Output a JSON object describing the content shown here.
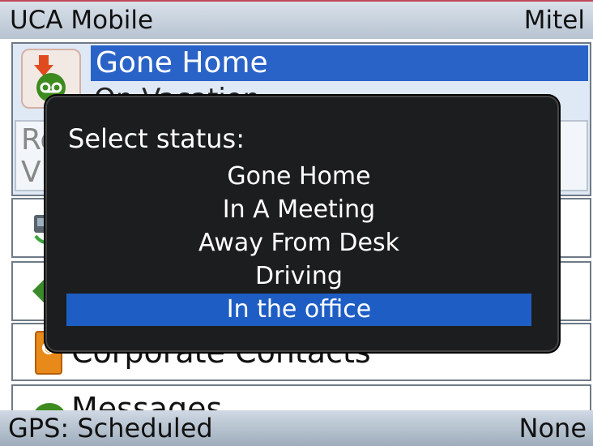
{
  "title_bar": {
    "app_name": "UCA Mobile",
    "brand": "Mitel"
  },
  "status_row": {
    "selected_status": "Gone Home",
    "note": "On Vacation",
    "inner_label_top": "Ro",
    "inner_label_bottom": "V"
  },
  "list": {
    "contacts_label": "Corporate Contacts",
    "messages_label": "Messages"
  },
  "dialog": {
    "title": "Select status:",
    "options": [
      "Gone Home",
      "In A Meeting",
      "Away From Desk",
      "Driving",
      "In the office"
    ],
    "selected_index": 4
  },
  "bottom_bar": {
    "left": "GPS: Scheduled",
    "right": "None"
  },
  "colors": {
    "selection": "#1e5ec4",
    "dialog_bg": "#1c1d1f",
    "title_bar": "#c8d2dd"
  }
}
